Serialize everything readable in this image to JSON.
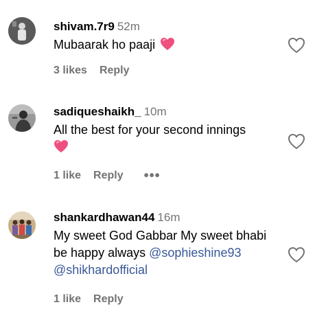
{
  "comments": [
    {
      "username": "shivam.7r9",
      "time": "52m",
      "text": "Mubaarak ho paaji",
      "likes": "3 likes",
      "reply": "Reply"
    },
    {
      "username": "sadiqueshaikh_",
      "time": "10m",
      "text": "All the best for your second innings",
      "likes": "1 like",
      "reply": "Reply",
      "more": "•••"
    },
    {
      "username": "shankardhawan44",
      "time": "16m",
      "text": "My sweet God Gabbar My sweet bhabi be happy always",
      "mention1": "@sophieshine93",
      "mention2": "@shikhardofficial",
      "likes": "1 like",
      "reply": "Reply"
    }
  ],
  "icons": {
    "like": "heart-outline-icon",
    "emoji": "pink-heart-emoji"
  },
  "colors": {
    "meta": "#737373",
    "mention": "#385898",
    "heart_emoji": "#e8336a"
  }
}
